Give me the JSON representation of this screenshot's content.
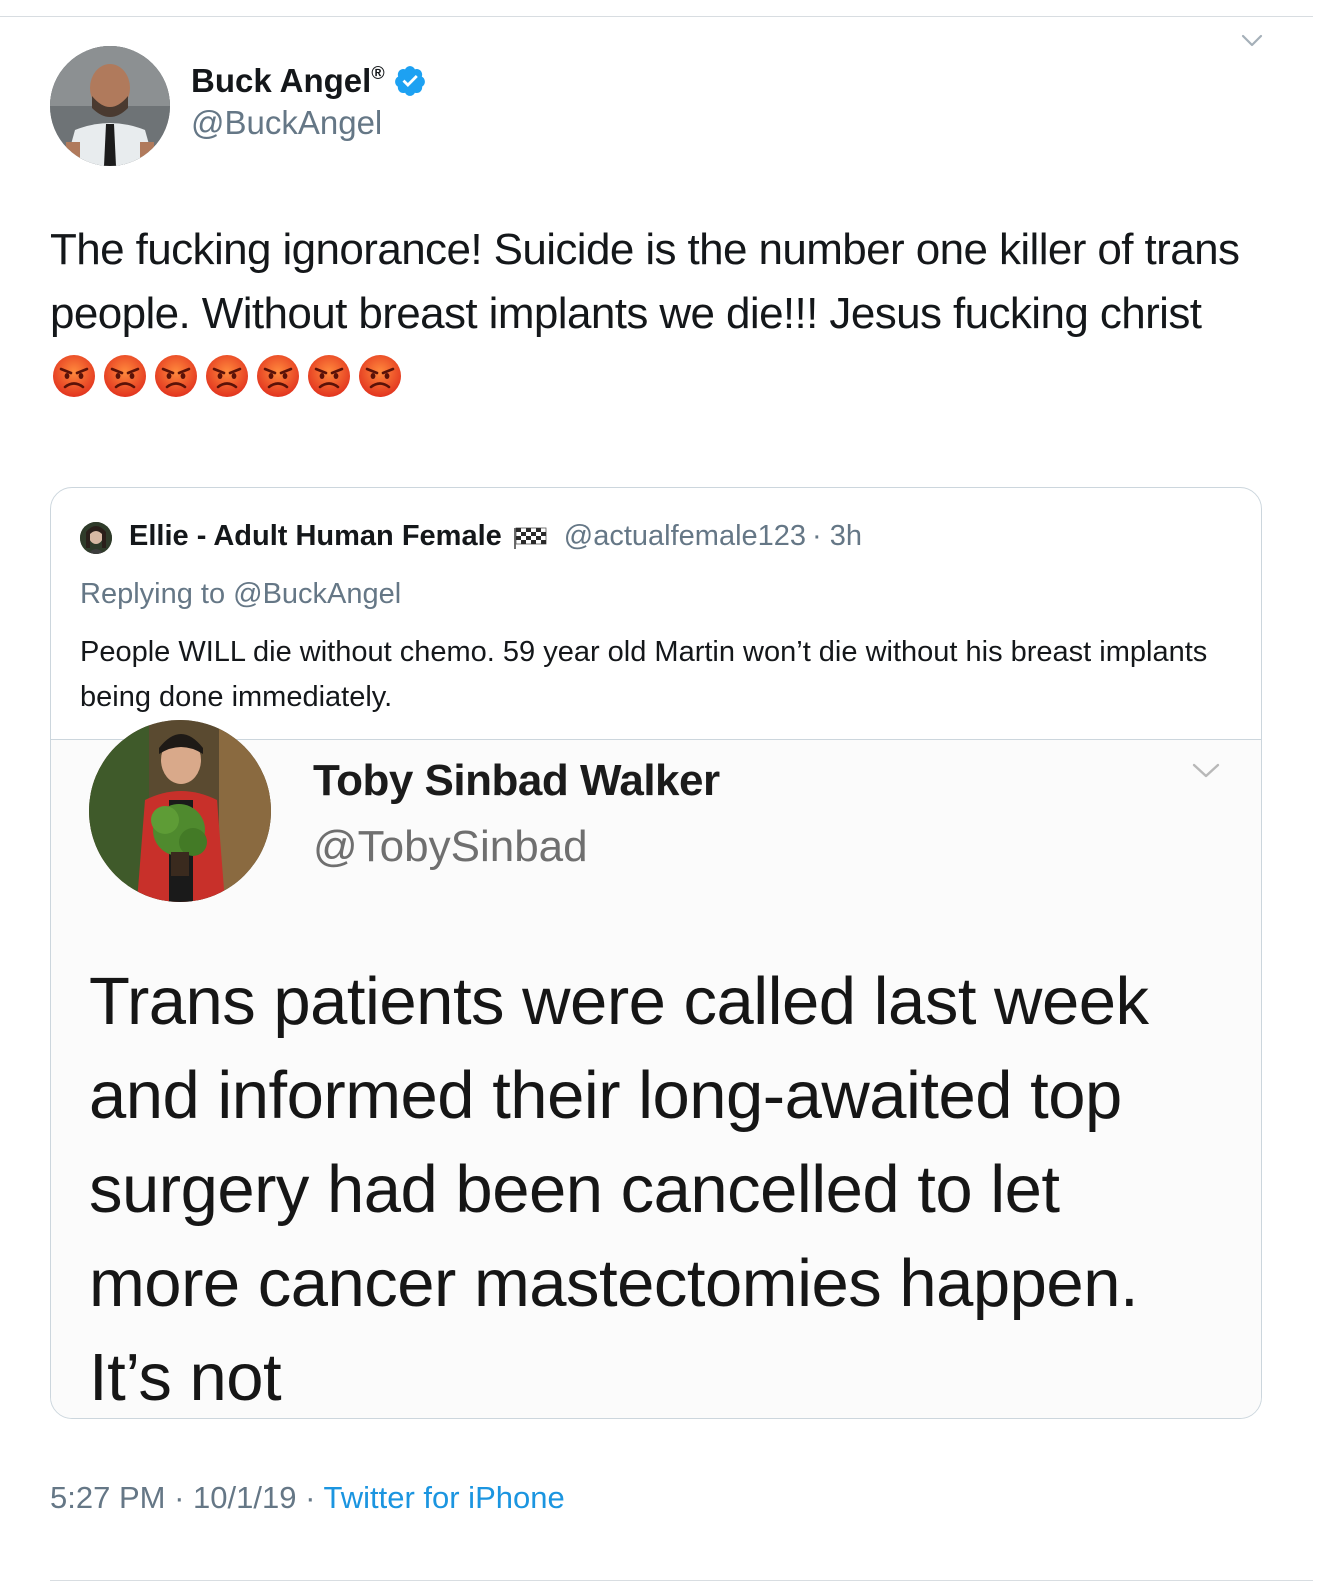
{
  "tweet": {
    "author_name": "Buck Angel",
    "registered_mark": "®",
    "author_handle": "@BuckAngel",
    "verified": true,
    "text": "The fucking ignorance! Suicide is the number one killer of trans people. Without breast implants we die!!! Jesus fucking christ",
    "emoji": [
      "angry-face",
      "angry-face",
      "angry-face",
      "angry-face",
      "angry-face",
      "angry-face",
      "angry-face"
    ],
    "time": "5:27 PM",
    "separator": "·",
    "date": "10/1/19",
    "source": "Twitter for iPhone"
  },
  "quote": {
    "author_name": "Ellie - Adult Human Female",
    "flag_icon": "chequered-flag-icon",
    "author_handle": "@actualfemale123",
    "age": "· 3h",
    "replying_to": "Replying to @BuckAngel",
    "text": "People WILL die without chemo. 59 year old Martin won’t die without his breast implants being done immediately.",
    "media": {
      "name": "Toby Sinbad Walker",
      "handle": "@TobySinbad",
      "text": "Trans patients were called last week and informed their long-awaited top surgery had been cancelled to let more cancer mastectomies happen. It’s not"
    }
  },
  "colors": {
    "accent": "#1b95e0",
    "secondary_text": "#657786",
    "border": "#ccd6dd",
    "verified": "#1da1f2"
  }
}
